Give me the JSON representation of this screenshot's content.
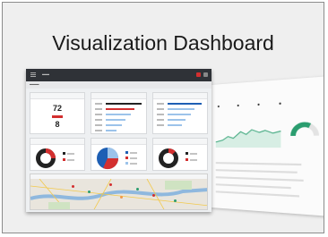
{
  "card": {
    "title": "Visualization Dashboard"
  },
  "main_dashboard": {
    "kpis": {
      "primary_value": "72",
      "secondary_value": "8"
    }
  },
  "colors": {
    "accent_red": "#d32f2f",
    "accent_blue": "#1e5fb4",
    "light_blue": "#9cc3ea",
    "dark": "#222222",
    "green": "#2a9d6f"
  },
  "icons": [
    "menu-icon",
    "settings-icon"
  ]
}
